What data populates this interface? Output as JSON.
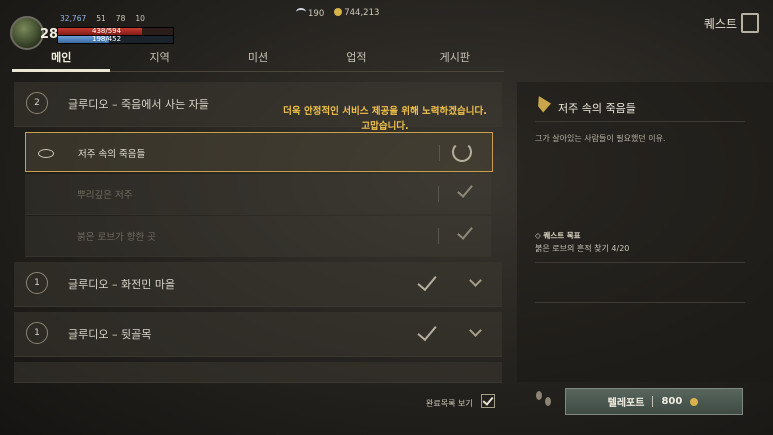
{
  "hud": {
    "level": "28",
    "exp": "32,767",
    "stat_a": "51",
    "stat_b": "78",
    "stat_c": "10",
    "hp_text": "438/594",
    "mp_text": "198/452",
    "wings": "190",
    "gold": "744,213"
  },
  "header": {
    "title": "퀘스트"
  },
  "tabs": [
    {
      "label": "메인"
    },
    {
      "label": "지역"
    },
    {
      "label": "미션"
    },
    {
      "label": "업적"
    },
    {
      "label": "게시판"
    }
  ],
  "chapters": [
    {
      "number": "2",
      "title": "글루디오 – 죽음에서 사는 자들"
    },
    {
      "number": "1",
      "title": "글루디오 – 화전민 마을"
    },
    {
      "number": "1",
      "title": "글루디오 – 뒷골목"
    }
  ],
  "quests": [
    {
      "label": "저주 속의 죽음들"
    },
    {
      "label": "뿌리깊은 저주"
    },
    {
      "label": "붉은 로브가 향한 곳"
    }
  ],
  "notice": {
    "line1": "더욱 안정적인 서비스 제공을 위해 노력하겠습니다.",
    "line2": "고맙습니다."
  },
  "detail": {
    "title": "저주 속의 죽음들",
    "description": "그가 살아있는 사람들이 필요했던 이유.",
    "goal_label": "퀘스트 목표",
    "goal_text": "붉은 로브의 흔적 찾기 4/20"
  },
  "footer": {
    "show_completed": "완료목록 보기",
    "teleport_label": "텔레포트",
    "teleport_cost": "800"
  }
}
